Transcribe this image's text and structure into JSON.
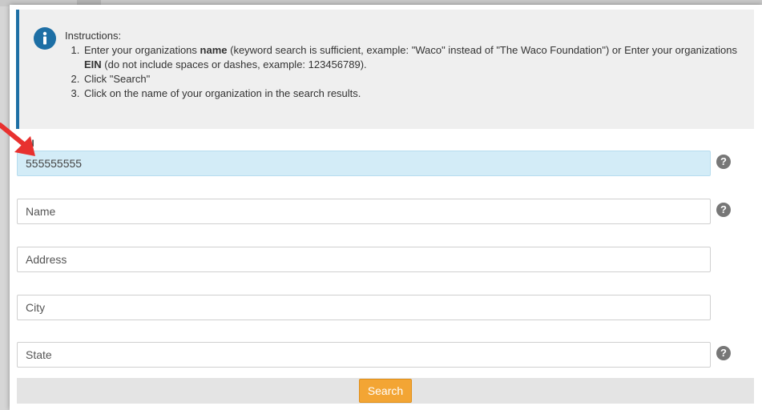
{
  "instructions": {
    "heading": "Instructions:",
    "step1_a": "Enter your organizations ",
    "step1_b": "name",
    "step1_c": " (keyword search is sufficient, example: \"Waco\" instead of \"The Waco Foundation\") or Enter your organizations ",
    "step1_d": "EIN",
    "step1_e": " (do not include spaces or dashes, example: 123456789).",
    "step2": "Click \"Search\"",
    "step3": "Click on the name of your organization in the search results."
  },
  "form": {
    "ein_label": "N",
    "ein_value": "555555555",
    "name_placeholder": "Name",
    "address_placeholder": "Address",
    "city_placeholder": "City",
    "state_placeholder": "State",
    "help_glyph": "?",
    "search_label": "Search"
  },
  "colors": {
    "accent_border": "#1d6fa5",
    "info_icon": "#1d6fa5",
    "ein_highlight": "#d3ecf7",
    "search_button": "#f3a534",
    "annotation_arrow": "#e8312f"
  },
  "icons": [
    "info-icon",
    "help-icon",
    "red-arrow-annotation"
  ]
}
